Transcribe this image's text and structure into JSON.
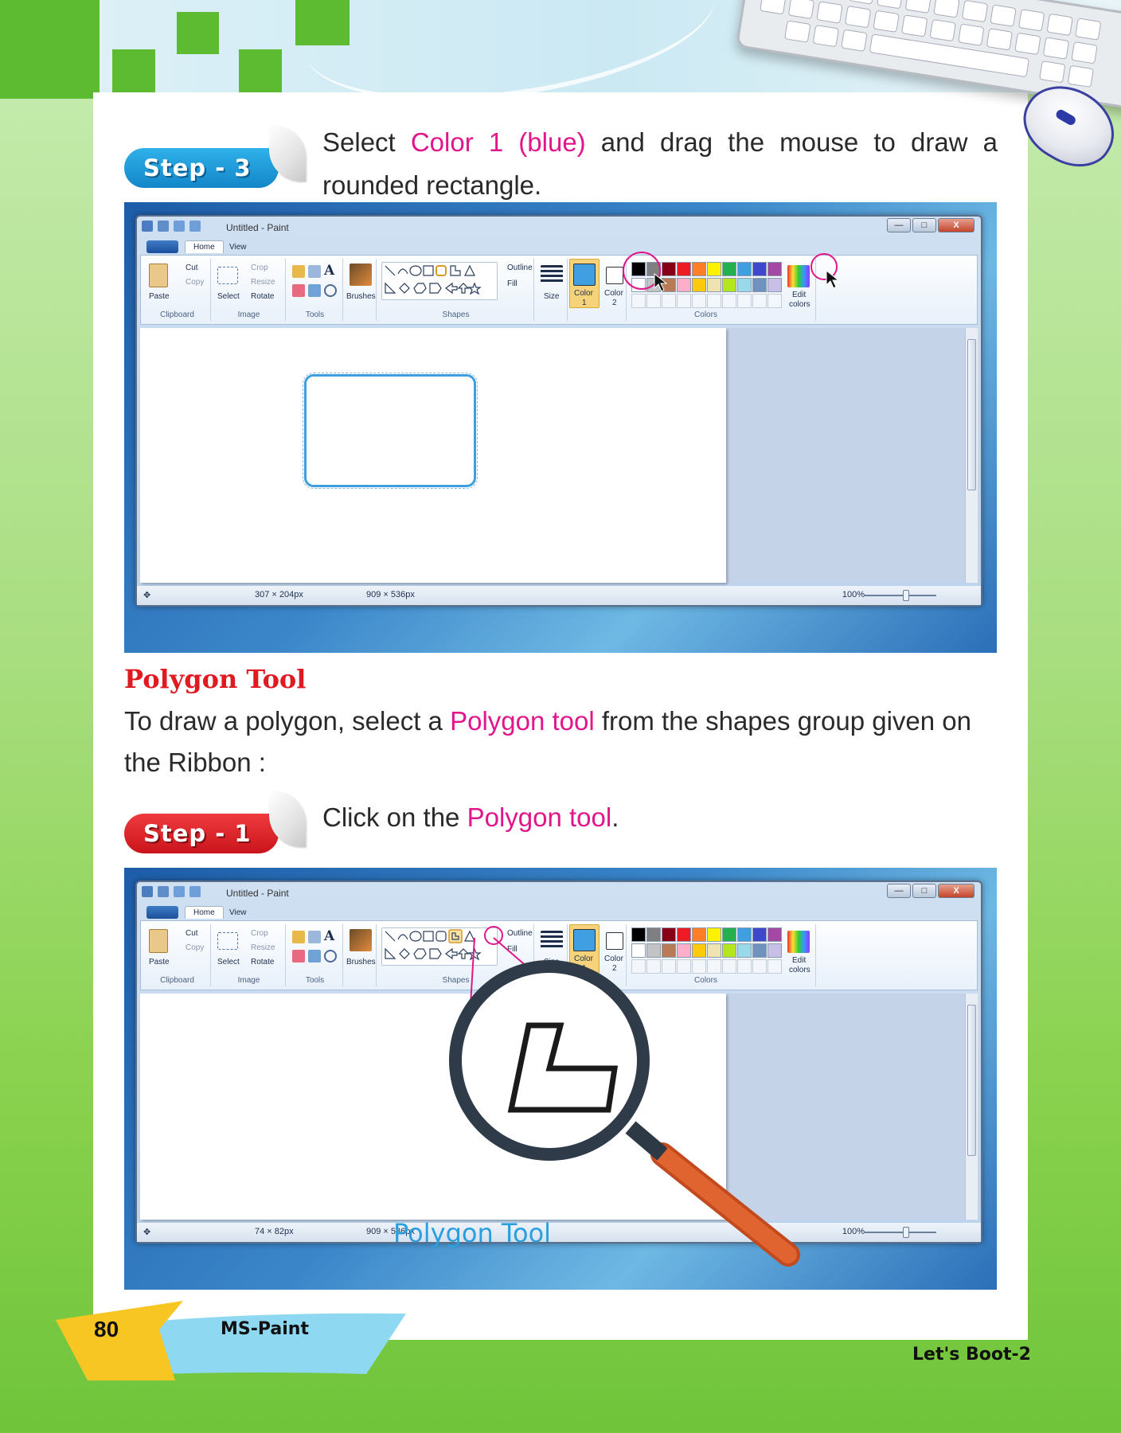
{
  "page": {
    "step3_badge": "Step - 3",
    "step3_text_1": "Select ",
    "step3_highlight": "Color 1 (blue)",
    "step3_text_2": " and drag the mouse to draw a rounded rectangle.",
    "section_heading": "Polygon Tool",
    "intro_text_1": "To draw a polygon, select a ",
    "intro_highlight": "Polygon tool",
    "intro_text_2": " from the shapes group given on the Ribbon :",
    "step1_badge": "Step - 1",
    "step1_text_1": "Click on the ",
    "step1_highlight": "Polygon tool",
    "step1_text_2": ".",
    "page_number": "80",
    "chapter_tag": "MS-Paint",
    "book_title": "Let's Boot-2"
  },
  "paint": {
    "window_title": "Untitled - Paint",
    "tabs": [
      "Home",
      "View"
    ],
    "clipboard": {
      "paste": "Paste",
      "cut": "Cut",
      "copy": "Copy",
      "group": "Clipboard"
    },
    "image": {
      "select": "Select",
      "crop": "Crop",
      "resize": "Resize",
      "rotate": "Rotate",
      "group": "Image"
    },
    "tools_group": "Tools",
    "brushes": "Brushes",
    "shapes": {
      "outline": "Outline",
      "fill": "Fill",
      "group": "Shapes"
    },
    "size": "Size",
    "color1": "Color\n1",
    "color1_a": "Color",
    "color1_b": "1",
    "color2_a": "Color",
    "color2_b": "2",
    "edit_colors_a": "Edit",
    "edit_colors_b": "colors",
    "colors_group": "Colors",
    "zoom": "100%",
    "canvas_size": "909 × 536px",
    "shot1_selection": "307 × 204px",
    "shot2_selection": "74 × 82px",
    "magnifier_caption": "Polygon Tool"
  },
  "palette_row1": [
    "#000000",
    "#7f7f7f",
    "#880015",
    "#ed1c24",
    "#ff7f27",
    "#fff200",
    "#22b14c",
    "#3f9fe0",
    "#3f48cc",
    "#a349a4"
  ],
  "palette_row2": [
    "#ffffff",
    "#c3c3c3",
    "#b97a57",
    "#ffaec9",
    "#ffc90e",
    "#efe4b0",
    "#b5e61d",
    "#99d9ea",
    "#7092be",
    "#c8bfe7"
  ],
  "colors": {
    "accent_pink": "#e0168a",
    "heading_red": "#e11920",
    "color1_blue": "#3d9ee0"
  }
}
